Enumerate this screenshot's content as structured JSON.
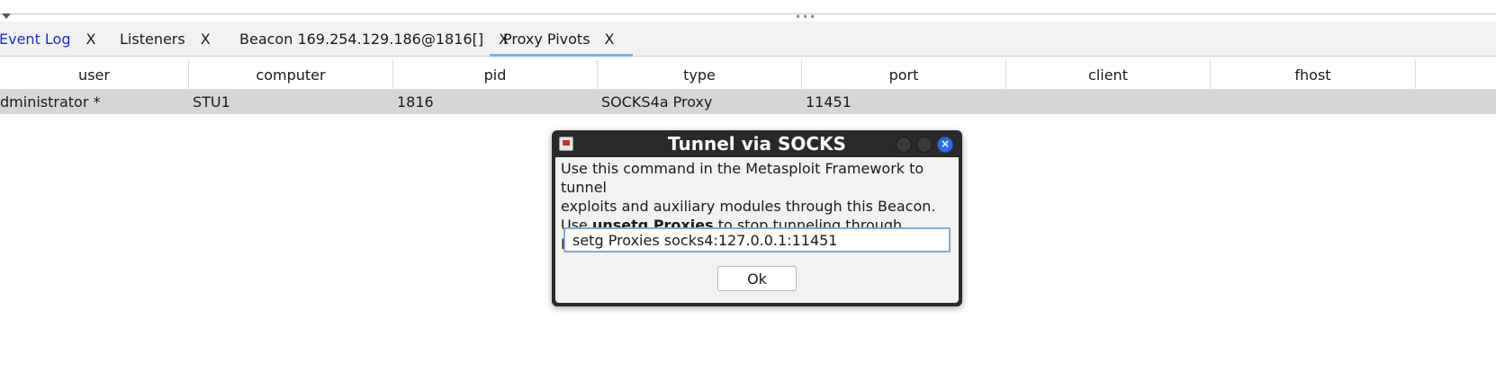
{
  "tabs": [
    {
      "label": "Event Log",
      "close": "X"
    },
    {
      "label": "Listeners",
      "close": "X"
    },
    {
      "label": "Beacon 169.254.129.186@1816[]",
      "close": "X"
    },
    {
      "label": "Proxy Pivots",
      "close": "X"
    }
  ],
  "split_grip": "•••",
  "table": {
    "columns": [
      "user",
      "computer",
      "pid",
      "type",
      "port",
      "client",
      "fhost"
    ],
    "rows": [
      {
        "user": "dministrator *",
        "computer": "STU1",
        "pid": "1816",
        "type": "SOCKS4a Proxy",
        "port": "11451",
        "client": "",
        "fhost": ""
      }
    ]
  },
  "dialog": {
    "title": "Tunnel via SOCKS",
    "line1": "Use this command in the Metasploit Framework to tunnel",
    "line2": "exploits and auxiliary modules through this Beacon.",
    "line3_prefix": "Use ",
    "line3_bold": "unsetg Proxies",
    "line3_suffix": " to stop tunneling through Beacon.",
    "command": "setg Proxies socks4:127.0.0.1:11451",
    "ok_label": "Ok",
    "close_glyph": "×"
  },
  "colors": {
    "active_tab_underline": "#86aed7",
    "event_log_link": "#1f2bd6",
    "selected_row": "#d6d6d6",
    "dialog_frame": "#2a2a2a",
    "close_button": "#2f6de0"
  }
}
